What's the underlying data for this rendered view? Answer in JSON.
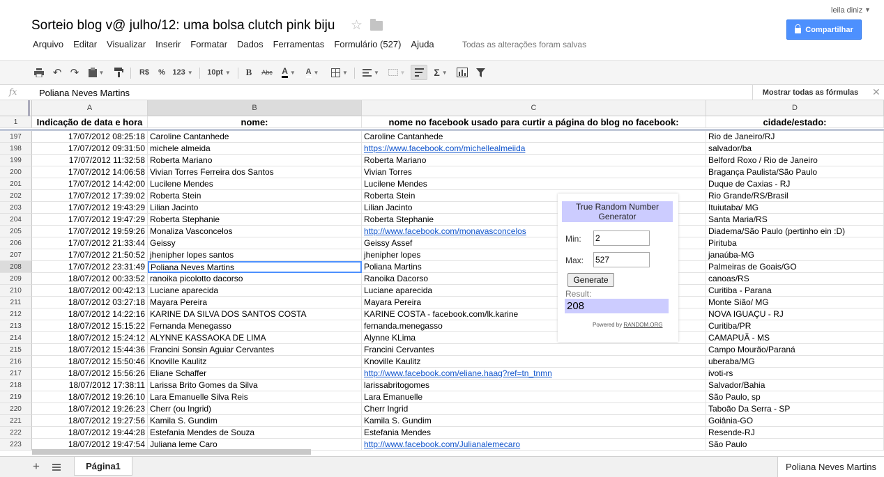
{
  "header": {
    "title": "Sorteio blog v@ julho/12: uma bolsa clutch pink biju",
    "user": "leila diniz",
    "share_label": "Compartilhar",
    "save_status": "Todas as alterações foram salvas"
  },
  "menu": [
    "Arquivo",
    "Editar",
    "Visualizar",
    "Inserir",
    "Formatar",
    "Dados",
    "Ferramentas",
    "Formulário (527)",
    "Ajuda"
  ],
  "toolbar": {
    "currency": "R$",
    "percent": "%",
    "number_format": "123",
    "font_size": "10pt",
    "bold": "B",
    "strike": "Abc",
    "text_color": "A",
    "fill_color": "A",
    "sum": "Σ"
  },
  "formula_bar": {
    "fx": "fx",
    "value": "Poliana Neves Martins",
    "show_formulas": "Mostrar todas as fórmulas"
  },
  "columns": [
    "A",
    "B",
    "C",
    "D"
  ],
  "header_row": {
    "num": "1",
    "cells": [
      "Indicação de data e hora",
      "nome:",
      "nome no facebook usado para curtir a página do blog no facebook:",
      "cidade/estado:"
    ]
  },
  "rows": [
    {
      "num": "197",
      "a": "17/07/2012 08:25:18",
      "b": "Caroline Cantanhede",
      "c": "Caroline Cantanhede",
      "d": "Rio de Janeiro/RJ",
      "link": false
    },
    {
      "num": "198",
      "a": "17/07/2012 09:31:50",
      "b": "michele almeida",
      "c": "https://www.facebook.com/michellealmeiida",
      "d": "salvador/ba",
      "link": true
    },
    {
      "num": "199",
      "a": "17/07/2012 11:32:58",
      "b": "Roberta Mariano",
      "c": "Roberta Mariano",
      "d": "Belford Roxo / Rio de Janeiro",
      "link": false
    },
    {
      "num": "200",
      "a": "17/07/2012 14:06:58",
      "b": "Vivian Torres Ferreira dos Santos",
      "c": "Vivian Torres",
      "d": "Bragança Paulista/São Paulo",
      "link": false
    },
    {
      "num": "201",
      "a": "17/07/2012 14:42:00",
      "b": "Lucilene Mendes",
      "c": "Lucilene Mendes",
      "d": "Duque de Caxias - RJ",
      "link": false
    },
    {
      "num": "202",
      "a": "17/07/2012 17:39:02",
      "b": "Roberta Stein",
      "c": "Roberta Stein",
      "d": "Rio Grande/RS/Brasil",
      "link": false
    },
    {
      "num": "203",
      "a": "17/07/2012 19:43:29",
      "b": "Lilian Jacinto",
      "c": "Lilian Jacinto",
      "d": "Ituiutaba/ MG",
      "link": false
    },
    {
      "num": "204",
      "a": "17/07/2012 19:47:29",
      "b": "Roberta Stephanie",
      "c": "Roberta Stephanie",
      "d": "Santa Maria/RS",
      "link": false
    },
    {
      "num": "205",
      "a": "17/07/2012 19:59:26",
      "b": "Monaliza Vasconcelos",
      "c": "http://www.facebook.com/monavasconcelos",
      "d": "Diadema/São Paulo (pertinho ein :D)",
      "link": true
    },
    {
      "num": "206",
      "a": "17/07/2012 21:33:44",
      "b": "Geissy",
      "c": "Geissy Assef",
      "d": "Pirituba",
      "link": false
    },
    {
      "num": "207",
      "a": "17/07/2012 21:50:52",
      "b": "jhenipher lopes santos",
      "c": "jhenipher lopes",
      "d": "janaúba-MG",
      "link": false
    },
    {
      "num": "208",
      "a": "17/07/2012 23:31:49",
      "b": "Poliana Neves Martins",
      "c": "Poliana Martins",
      "d": "Palmeiras de Goais/GO",
      "link": false
    },
    {
      "num": "209",
      "a": "18/07/2012 00:33:52",
      "b": "ranoika picolotto dacorso",
      "c": "Ranoika Dacorso",
      "d": "canoas/RS",
      "link": false
    },
    {
      "num": "210",
      "a": "18/07/2012 00:42:13",
      "b": "Luciane aparecida",
      "c": "Luciane aparecida",
      "d": "Curitiba - Parana",
      "link": false
    },
    {
      "num": "211",
      "a": "18/07/2012 03:27:18",
      "b": "Mayara Pereira",
      "c": "Mayara Pereira",
      "d": "Monte Sião/ MG",
      "link": false
    },
    {
      "num": "212",
      "a": "18/07/2012 14:22:16",
      "b": "KARINE DA SILVA DOS SANTOS COSTA",
      "c": "KARINE COSTA - facebook.com/lk.karine",
      "d": "NOVA IGUAÇU - RJ",
      "link": false
    },
    {
      "num": "213",
      "a": "18/07/2012 15:15:22",
      "b": "Fernanda Menegasso",
      "c": "fernanda.menegasso",
      "d": "Curitiba/PR",
      "link": false
    },
    {
      "num": "214",
      "a": "18/07/2012 15:24:12",
      "b": "ALYNNE KASSAOKA DE LIMA",
      "c": "Alynne KLima",
      "d": "CAMAPUÃ - MS",
      "link": false
    },
    {
      "num": "215",
      "a": "18/07/2012 15:44:36",
      "b": "Francini Sonsin Aguiar Cervantes",
      "c": "Francini Cervantes",
      "d": "Campo Mourão/Paraná",
      "link": false
    },
    {
      "num": "216",
      "a": "18/07/2012 15:50:46",
      "b": "Knoville Kaulitz",
      "c": "Knoville Kaulitz",
      "d": "uberaba/MG",
      "link": false
    },
    {
      "num": "217",
      "a": "18/07/2012 15:56:26",
      "b": "Eliane Schaffer",
      "c": "http://www.facebook.com/eliane.haag?ref=tn_tnmn",
      "d": "ivoti-rs",
      "link": true
    },
    {
      "num": "218",
      "a": "18/07/2012 17:38:11",
      "b": "Larissa Brito Gomes da Silva",
      "c": "larissabritogomes",
      "d": "Salvador/Bahia",
      "link": false
    },
    {
      "num": "219",
      "a": "18/07/2012 19:26:10",
      "b": "Lara Emanuelle Silva Reis",
      "c": "Lara Emanuelle",
      "d": "São Paulo, sp",
      "link": false
    },
    {
      "num": "220",
      "a": "18/07/2012 19:26:23",
      "b": "Cherr (ou Ingrid)",
      "c": "Cherr Ingrid",
      "d": "Taboão Da Serra - SP",
      "link": false
    },
    {
      "num": "221",
      "a": "18/07/2012 19:27:56",
      "b": "Kamila S. Gundim",
      "c": "Kamila S. Gundim",
      "d": "Goiânia-GO",
      "link": false
    },
    {
      "num": "222",
      "a": "18/07/2012 19:44:28",
      "b": "Estefania Mendes de Souza",
      "c": "Estefania Mendes",
      "d": "Resende-RJ",
      "link": false
    },
    {
      "num": "223",
      "a": "18/07/2012 19:47:54",
      "b": "Juliana leme Caro",
      "c": "http://www.facebook.com/Julianalemecaro",
      "d": "São Paulo",
      "link": true
    }
  ],
  "selected_row": "208",
  "rng": {
    "title": "True Random Number Generator",
    "min_label": "Min:",
    "min_value": "2",
    "max_label": "Max:",
    "max_value": "527",
    "generate_label": "Generate",
    "result_label": "Result:",
    "result_value": "208",
    "powered_by": "Powered by",
    "powered_site": "RANDOM.ORG"
  },
  "footer": {
    "add_sheet": "+",
    "sheet_tab": "Página1",
    "status_value": "Poliana Neves Martins"
  },
  "colors": {
    "accent": "#4d90fe",
    "link": "#1155cc",
    "rng_highlight": "#ccccff"
  }
}
